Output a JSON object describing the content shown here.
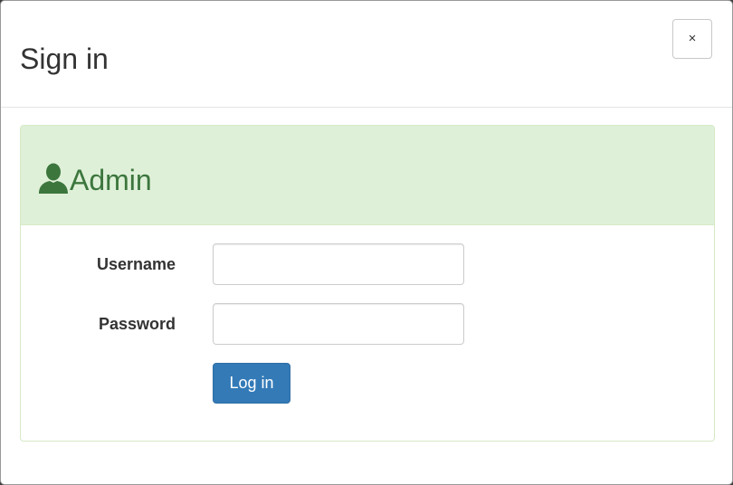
{
  "modal": {
    "title": "Sign in",
    "close_label": "×"
  },
  "panel": {
    "heading": "Admin",
    "heading_icon": "user-icon",
    "colors": {
      "heading_bg": "#dff0d8",
      "heading_text": "#3c763d",
      "border": "#d6e9c6"
    }
  },
  "form": {
    "username_label": "Username",
    "username_value": "",
    "password_label": "Password",
    "password_value": "",
    "submit_label": "Log in",
    "submit_color": "#337ab7"
  }
}
